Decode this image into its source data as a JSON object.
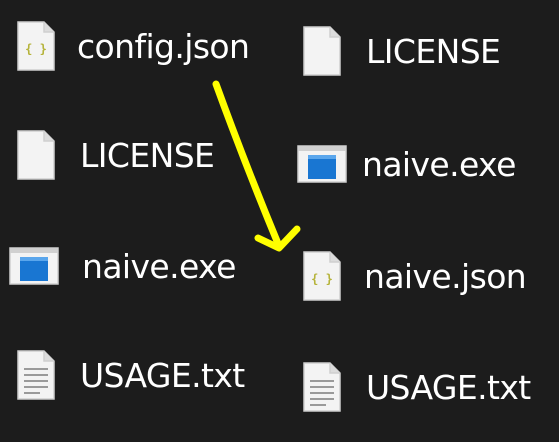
{
  "left_column": [
    {
      "label": "config.json",
      "icon": "json-file-icon"
    },
    {
      "label": "LICENSE",
      "icon": "blank-file-icon"
    },
    {
      "label": "naive.exe",
      "icon": "exe-file-icon"
    },
    {
      "label": "USAGE.txt",
      "icon": "text-file-icon"
    }
  ],
  "right_column": [
    {
      "label": "LICENSE",
      "icon": "blank-file-icon"
    },
    {
      "label": "naive.exe",
      "icon": "exe-file-icon"
    },
    {
      "label": "naive.json",
      "icon": "json-file-icon"
    },
    {
      "label": "USAGE.txt",
      "icon": "text-file-icon"
    }
  ],
  "annotation": {
    "arrow_color": "#ffff00"
  },
  "colors": {
    "background": "#1c1c1c",
    "text": "#ffffff",
    "exe_accent": "#1976d2",
    "json_brace": "#b5b33a"
  }
}
